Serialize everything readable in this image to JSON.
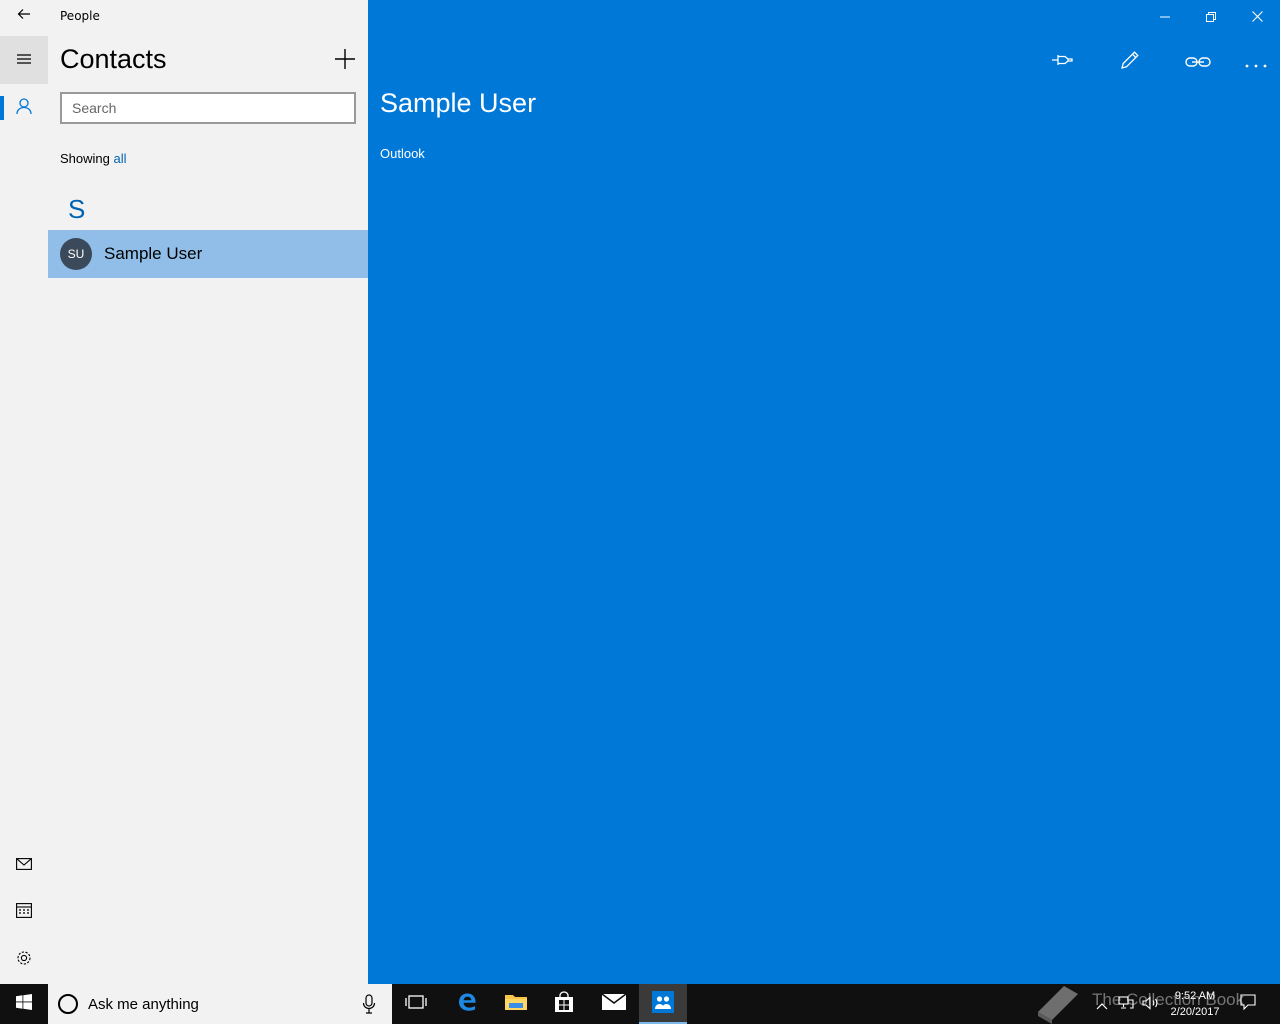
{
  "window": {
    "app_name": "People",
    "minimize_label": "",
    "restore_label": "",
    "close_label": ""
  },
  "rail": {
    "icons": [
      "back-arrow-icon",
      "hamburger-icon",
      "person-icon",
      "mail-icon",
      "calendar-icon",
      "gear-icon"
    ],
    "accent_color": "#0078d7"
  },
  "list": {
    "title": "Contacts",
    "search_placeholder": "Search",
    "showing_prefix": "Showing",
    "showing_filter": "all",
    "groups": [
      {
        "letter": "S",
        "contacts": [
          {
            "initials": "SU",
            "name": "Sample User",
            "selected": true
          }
        ]
      }
    ]
  },
  "detail": {
    "name": "Sample User",
    "source": "Outlook",
    "background_color": "#0078d7",
    "commands": [
      "pin-icon",
      "edit-pencil-icon",
      "link-icon",
      "more-icon"
    ]
  },
  "taskbar": {
    "search_text": "Ask me anything",
    "time": "9:52 AM",
    "date": "2/20/2017",
    "watermark": "The Collection Book",
    "pinned": [
      "task-view-icon",
      "edge-icon",
      "file-explorer-icon",
      "store-icon",
      "mail-icon",
      "people-icon"
    ]
  }
}
